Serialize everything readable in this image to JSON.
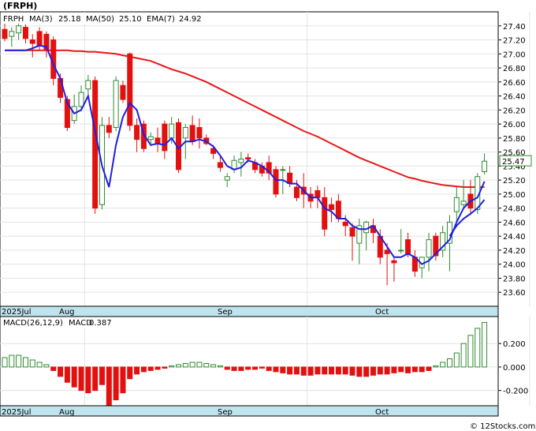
{
  "title": "(FRPH)",
  "copyright": "© 12Stocks.com",
  "colors": {
    "up": "#2e8b2e",
    "down": "#e31010",
    "ma3": "#1f1fe0",
    "ma50": "#e81818",
    "axis_strip": "#bfe4ee"
  },
  "chart_data": [
    {
      "type": "candlestick",
      "legend": {
        "symbol": "FRPH",
        "ma3": "MA(3)",
        "ma3_value": "25.18",
        "ma50": "MA(50)",
        "ma50_value": "25.10",
        "ema7": "EMA(7)",
        "ema7_value": "24.92"
      },
      "last_price_label": "25.47",
      "ylim": [
        23.4,
        27.6
      ],
      "yticks": [
        "27.40",
        "27.20",
        "27.00",
        "26.80",
        "26.60",
        "26.40",
        "26.20",
        "26.00",
        "25.80",
        "25.60",
        "25.40",
        "25.20",
        "25.00",
        "24.80",
        "24.60",
        "24.40",
        "24.20",
        "24.00",
        "23.80",
        "23.60"
      ],
      "month_labels": [
        "2025Jul",
        "Aug",
        "Sep",
        "Oct"
      ],
      "candles": [
        [
          27.35,
          27.45,
          27.18,
          27.22
        ],
        [
          27.25,
          27.38,
          27.1,
          27.32
        ],
        [
          27.3,
          27.48,
          27.2,
          27.4
        ],
        [
          27.38,
          27.42,
          27.15,
          27.22
        ],
        [
          27.2,
          27.28,
          26.95,
          27.15
        ],
        [
          27.32,
          27.38,
          27.05,
          27.12
        ],
        [
          27.28,
          27.32,
          26.95,
          27.05
        ],
        [
          27.2,
          27.25,
          26.55,
          26.65
        ],
        [
          26.65,
          26.72,
          26.3,
          26.38
        ],
        [
          26.35,
          26.4,
          25.9,
          25.95
        ],
        [
          26.05,
          26.42,
          26.0,
          26.25
        ],
        [
          26.25,
          26.55,
          26.18,
          26.45
        ],
        [
          26.5,
          26.7,
          26.42,
          26.62
        ],
        [
          26.62,
          26.68,
          24.72,
          24.8
        ],
        [
          24.85,
          26.1,
          24.78,
          25.98
        ],
        [
          25.98,
          26.1,
          25.8,
          25.88
        ],
        [
          25.95,
          26.68,
          25.9,
          26.62
        ],
        [
          26.55,
          26.62,
          26.3,
          26.35
        ],
        [
          27.0,
          27.02,
          25.9,
          25.98
        ],
        [
          25.98,
          26.08,
          25.6,
          25.78
        ],
        [
          26.0,
          26.05,
          25.6,
          25.65
        ],
        [
          25.78,
          25.88,
          25.68,
          25.82
        ],
        [
          25.8,
          25.95,
          25.6,
          25.72
        ],
        [
          26.0,
          26.05,
          25.5,
          25.62
        ],
        [
          25.8,
          26.1,
          25.72,
          26.0
        ],
        [
          26.02,
          26.08,
          25.3,
          25.35
        ],
        [
          25.8,
          26.0,
          25.5,
          25.95
        ],
        [
          25.98,
          26.12,
          25.7,
          25.75
        ],
        [
          25.95,
          26.08,
          25.65,
          25.8
        ],
        [
          25.8,
          25.85,
          25.7,
          25.72
        ],
        [
          25.65,
          25.7,
          25.5,
          25.58
        ],
        [
          25.45,
          25.55,
          25.32,
          25.38
        ],
        [
          25.2,
          25.3,
          25.1,
          25.25
        ],
        [
          25.35,
          25.55,
          25.3,
          25.48
        ],
        [
          25.45,
          25.6,
          25.25,
          25.5
        ],
        [
          25.52,
          25.58,
          25.45,
          25.5
        ],
        [
          25.45,
          25.5,
          25.3,
          25.35
        ],
        [
          25.4,
          25.45,
          25.25,
          25.3
        ],
        [
          25.45,
          25.55,
          25.2,
          25.3
        ],
        [
          25.35,
          25.4,
          24.95,
          25.0
        ],
        [
          25.35,
          25.4,
          25.0,
          25.35
        ],
        [
          25.3,
          25.4,
          25.1,
          25.15
        ],
        [
          25.1,
          25.2,
          24.9,
          24.95
        ],
        [
          25.1,
          25.3,
          24.8,
          25.0
        ],
        [
          25.0,
          25.1,
          24.8,
          24.9
        ],
        [
          25.05,
          25.12,
          24.8,
          24.95
        ],
        [
          24.95,
          25.1,
          24.4,
          24.5
        ],
        [
          24.85,
          24.95,
          24.6,
          24.78
        ],
        [
          24.9,
          25.0,
          24.6,
          24.65
        ],
        [
          24.6,
          24.7,
          24.4,
          24.55
        ],
        [
          24.52,
          24.58,
          24.05,
          24.4
        ],
        [
          24.3,
          24.65,
          24.0,
          24.55
        ],
        [
          24.45,
          24.62,
          24.2,
          24.6
        ],
        [
          24.55,
          24.65,
          24.3,
          24.45
        ],
        [
          24.4,
          24.5,
          24.0,
          24.1
        ],
        [
          24.2,
          24.3,
          23.7,
          24.15
        ],
        [
          24.05,
          24.1,
          23.75,
          24.02
        ],
        [
          24.2,
          24.5,
          24.15,
          24.2
        ],
        [
          24.35,
          24.45,
          24.1,
          24.15
        ],
        [
          24.1,
          24.2,
          23.82,
          23.9
        ],
        [
          23.95,
          24.1,
          23.8,
          24.1
        ],
        [
          24.1,
          24.45,
          23.9,
          24.35
        ],
        [
          24.4,
          24.45,
          24.05,
          24.12
        ],
        [
          24.2,
          24.55,
          24.1,
          24.45
        ],
        [
          24.3,
          24.7,
          23.9,
          24.6
        ],
        [
          24.75,
          25.1,
          24.6,
          24.95
        ],
        [
          24.85,
          25.2,
          24.8,
          24.9
        ],
        [
          25.0,
          25.2,
          24.7,
          24.8
        ],
        [
          24.78,
          25.3,
          24.72,
          25.25
        ],
        [
          25.32,
          25.58,
          25.28,
          25.47
        ]
      ],
      "ma3": [
        27.05,
        27.05,
        27.05,
        27.05,
        27.08,
        27.12,
        27.1,
        26.85,
        26.65,
        26.3,
        26.15,
        26.2,
        26.4,
        25.9,
        25.4,
        25.1,
        25.7,
        26.1,
        26.3,
        26.2,
        25.85,
        25.7,
        25.72,
        25.7,
        25.8,
        25.65,
        25.75,
        25.75,
        25.78,
        25.75,
        25.68,
        25.55,
        25.4,
        25.35,
        25.38,
        25.48,
        25.45,
        25.4,
        25.32,
        25.2,
        25.2,
        25.15,
        25.15,
        25.05,
        24.95,
        24.95,
        24.8,
        24.75,
        24.65,
        24.65,
        24.55,
        24.5,
        24.5,
        24.55,
        24.4,
        24.25,
        24.1,
        24.1,
        24.15,
        24.1,
        24.0,
        24.05,
        24.15,
        24.25,
        24.35,
        24.6,
        24.8,
        24.9,
        24.95,
        25.18
      ],
      "ema7": [
        null,
        null,
        null,
        null,
        null,
        null,
        null,
        null,
        null,
        null,
        null,
        null,
        null,
        null,
        null,
        null,
        null,
        null,
        null,
        null,
        null,
        null,
        null,
        null,
        null,
        null,
        null,
        null,
        null,
        null,
        null,
        null,
        null,
        null,
        null,
        null,
        null,
        null,
        null,
        null,
        null,
        null,
        null,
        null,
        null,
        null,
        null,
        null,
        null,
        null,
        null,
        null,
        null,
        null,
        null,
        null,
        null,
        null,
        null,
        null,
        null,
        null,
        null,
        null,
        24.4,
        24.55,
        24.65,
        24.72,
        24.8,
        24.92
      ],
      "ma50": [
        27.05,
        27.05,
        27.05,
        27.05,
        27.05,
        27.05,
        27.05,
        27.05,
        27.05,
        27.05,
        27.04,
        27.04,
        27.03,
        27.03,
        27.02,
        27.01,
        27.0,
        26.98,
        26.96,
        26.94,
        26.92,
        26.9,
        26.86,
        26.82,
        26.78,
        26.75,
        26.72,
        26.68,
        26.64,
        26.6,
        26.55,
        26.5,
        26.45,
        26.4,
        26.35,
        26.3,
        26.25,
        26.2,
        26.15,
        26.1,
        26.05,
        26.0,
        25.95,
        25.9,
        25.86,
        25.82,
        25.77,
        25.72,
        25.67,
        25.62,
        25.57,
        25.52,
        25.48,
        25.44,
        25.4,
        25.36,
        25.32,
        25.28,
        25.24,
        25.22,
        25.19,
        25.17,
        25.15,
        25.13,
        25.12,
        25.11,
        25.1,
        25.1,
        25.1,
        25.1
      ]
    },
    {
      "type": "bar",
      "legend": {
        "name": "MACD(26,12,9)",
        "value_name": "MACD",
        "value": "0.387"
      },
      "ylim": [
        -0.33,
        0.43
      ],
      "yticks": [
        "0.200",
        "0.000",
        "-0.200"
      ],
      "month_labels": [
        "2025Jul",
        "Aug",
        "Sep",
        "Oct"
      ],
      "values": [
        0.08,
        0.1,
        0.1,
        0.08,
        0.06,
        0.04,
        0.02,
        -0.03,
        -0.08,
        -0.13,
        -0.17,
        -0.2,
        -0.22,
        -0.2,
        -0.15,
        -0.34,
        -0.28,
        -0.22,
        -0.1,
        -0.06,
        -0.04,
        -0.03,
        -0.02,
        -0.01,
        0.01,
        0.02,
        0.03,
        0.04,
        0.04,
        0.03,
        0.02,
        0.01,
        -0.02,
        -0.03,
        -0.03,
        -0.02,
        -0.02,
        -0.01,
        -0.03,
        -0.04,
        -0.05,
        -0.06,
        -0.06,
        -0.07,
        -0.07,
        -0.06,
        -0.06,
        -0.06,
        -0.06,
        -0.06,
        -0.07,
        -0.08,
        -0.08,
        -0.07,
        -0.06,
        -0.06,
        -0.05,
        -0.04,
        -0.05,
        -0.04,
        -0.04,
        -0.03,
        0.01,
        0.04,
        0.07,
        0.12,
        0.2,
        0.27,
        0.33,
        0.38
      ]
    }
  ]
}
